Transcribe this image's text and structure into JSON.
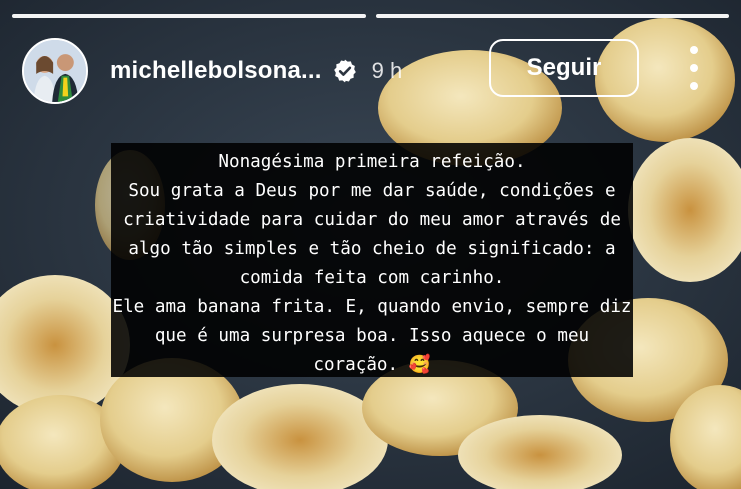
{
  "story": {
    "progress_segments": 2,
    "user": {
      "username": "michellebolsona...",
      "verified": true,
      "verified_icon": "verified-badge-icon",
      "time": "9 h"
    },
    "follow_label": "Seguir",
    "more_icon": "more-vertical-icon",
    "caption": {
      "lines": [
        "Nonagésima primeira refeição.",
        "Sou grata a Deus por me dar saúde, condições e",
        "criatividade para cuidar do meu amor através de",
        "algo tão simples e tão cheio de significado: a",
        "comida feita com carinho.",
        "Ele ama banana frita. E, quando envio, sempre diz",
        "que é uma surpresa boa. Isso aquece o meu",
        "coração. 🥰"
      ]
    },
    "background": "fried banana slices in a pan",
    "colors": {
      "pan": "#2a3440",
      "banana": "#e9d9a6",
      "browned": "#b88a3a"
    }
  }
}
